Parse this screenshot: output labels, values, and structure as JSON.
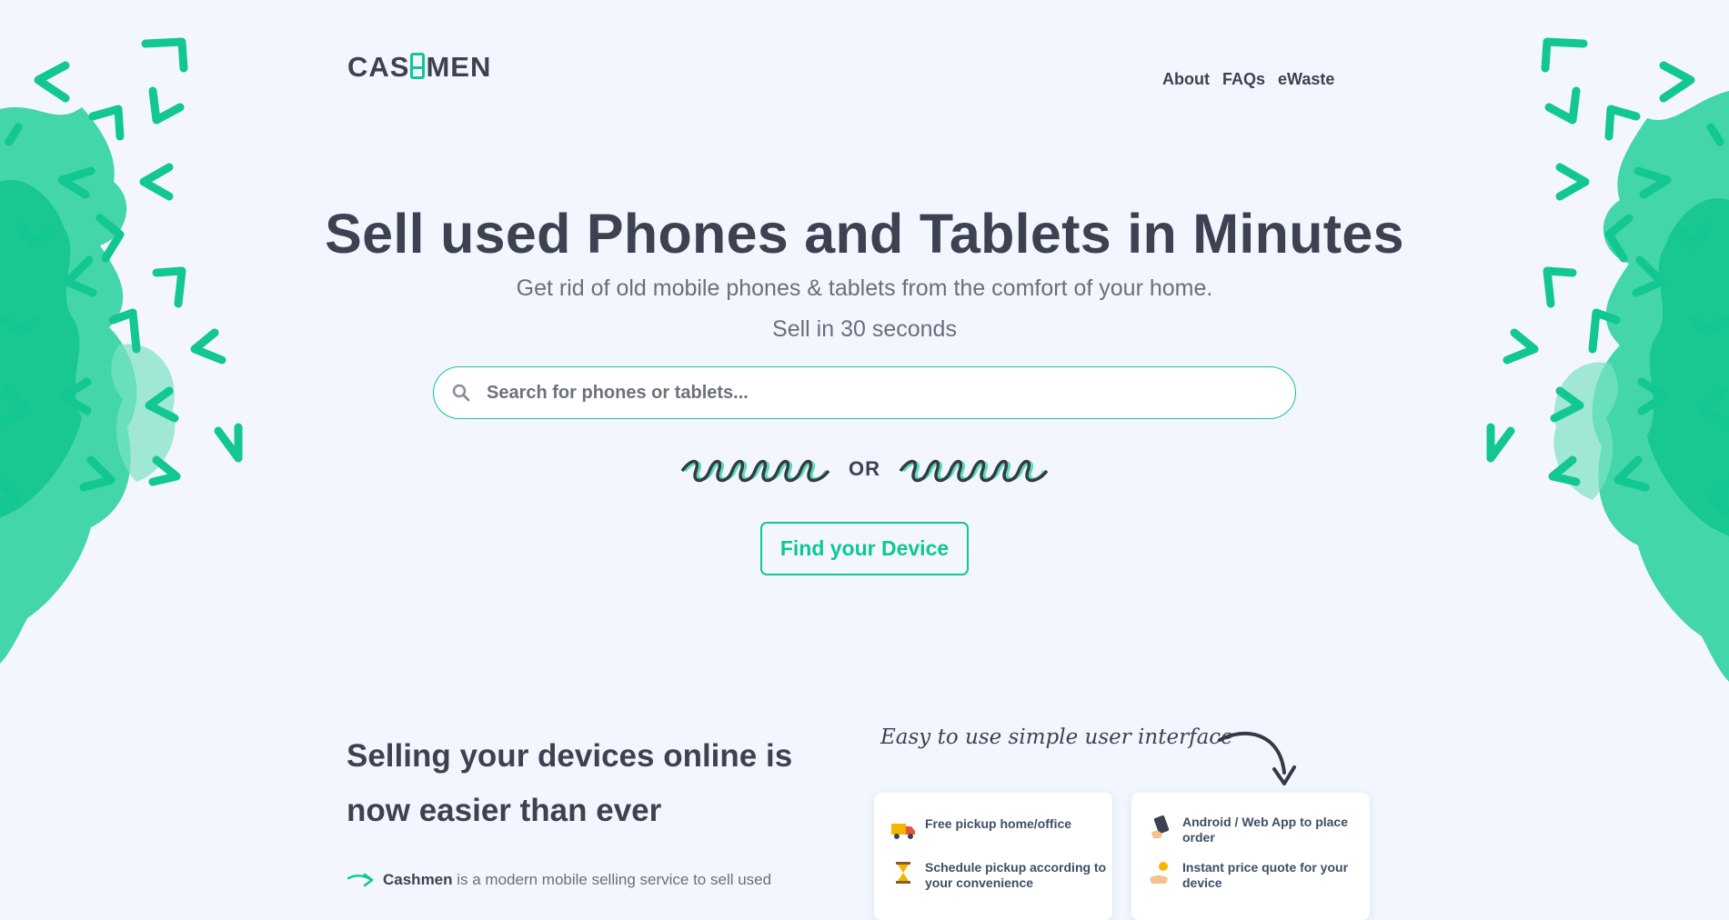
{
  "brand": {
    "logo_left": "CAS",
    "logo_right": "MEN"
  },
  "nav": {
    "items": [
      "About",
      "FAQs",
      "eWaste"
    ]
  },
  "hero": {
    "title": "Sell used Phones and Tablets in Minutes",
    "subtitle": "Get rid of old mobile phones & tablets from the comfort of your home.",
    "tagline": "Sell in 30 seconds",
    "search_placeholder": "Search for phones or tablets...",
    "or_text": "OR",
    "find_button": "Find your Device"
  },
  "section": {
    "title": "Selling your devices online is now easier than ever",
    "para_brand": "Cashmen",
    "para_text": " is a modern mobile selling service to sell used"
  },
  "handwritten_note": "Easy to use simple user interface",
  "feature_cards": [
    {
      "items": [
        {
          "text": "Free pickup home/office",
          "icon": "truck-icon"
        },
        {
          "text": "Schedule pickup according to your convenience",
          "icon": "hourglass-icon"
        }
      ]
    },
    {
      "items": [
        {
          "text": "Android / Web App to place order",
          "icon": "phone-hand-icon"
        },
        {
          "text": "Instant price quote for your device",
          "icon": "coin-hand-icon"
        }
      ]
    }
  ],
  "colors": {
    "accent": "#0fc795",
    "text": "#3d4252",
    "background": "#f3f6fe"
  }
}
